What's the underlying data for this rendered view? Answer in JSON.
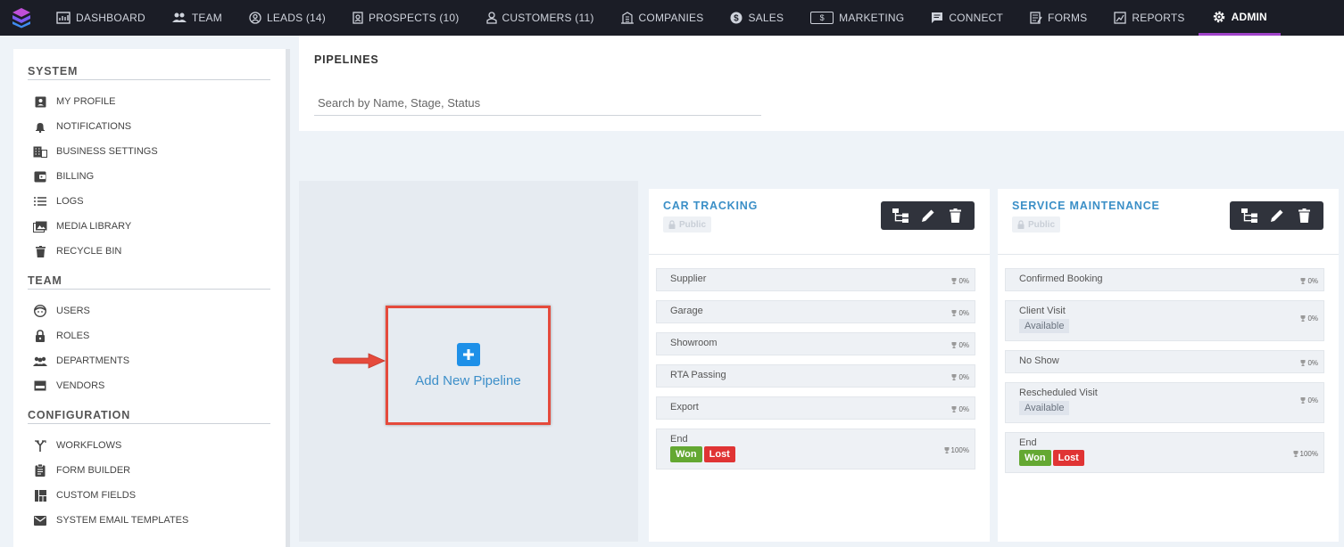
{
  "nav": {
    "items": [
      {
        "label": "DASHBOARD"
      },
      {
        "label": "TEAM"
      },
      {
        "label": "LEADS (14)"
      },
      {
        "label": "PROSPECTS (10)"
      },
      {
        "label": "CUSTOMERS (11)"
      },
      {
        "label": "COMPANIES"
      },
      {
        "label": "SALES"
      },
      {
        "label": "MARKETING"
      },
      {
        "label": "CONNECT"
      },
      {
        "label": "FORMS"
      },
      {
        "label": "REPORTS"
      },
      {
        "label": "ADMIN"
      }
    ],
    "money_glyph": "$",
    "active": "ADMIN",
    "accent": "#a043c9"
  },
  "sidebar": {
    "sections": [
      {
        "title": "SYSTEM",
        "items": [
          "MY PROFILE",
          "NOTIFICATIONS",
          "BUSINESS SETTINGS",
          "BILLING",
          "LOGS",
          "MEDIA LIBRARY",
          "RECYCLE BIN"
        ]
      },
      {
        "title": "TEAM",
        "items": [
          "USERS",
          "ROLES",
          "DEPARTMENTS",
          "VENDORS"
        ]
      },
      {
        "title": "CONFIGURATION",
        "items": [
          "WORKFLOWS",
          "FORM BUILDER",
          "CUSTOM FIELDS",
          "SYSTEM EMAIL TEMPLATES"
        ]
      }
    ]
  },
  "main": {
    "title": "PIPELINES",
    "search_placeholder": "Search by Name, Stage, Status",
    "add_label": "Add New Pipeline"
  },
  "pipelines": [
    {
      "title": "CAR TRACKING",
      "visibility": "Public",
      "stages": [
        {
          "name": "Supplier",
          "pct": "0%"
        },
        {
          "name": "Garage",
          "pct": "0%"
        },
        {
          "name": "Showroom",
          "pct": "0%"
        },
        {
          "name": "RTA Passing",
          "pct": "0%"
        },
        {
          "name": "Export",
          "pct": "0%"
        },
        {
          "name": "End",
          "pct": "100%",
          "won": "Won",
          "lost": "Lost"
        }
      ]
    },
    {
      "title": "SERVICE MAINTENANCE",
      "visibility": "Public",
      "stages": [
        {
          "name": "Confirmed Booking",
          "pct": "0%"
        },
        {
          "name": "Client Visit",
          "pct": "0%",
          "tag": "Available"
        },
        {
          "name": "No Show",
          "pct": "0%"
        },
        {
          "name": "Rescheduled Visit",
          "pct": "0%",
          "tag": "Available"
        },
        {
          "name": "End",
          "pct": "100%",
          "won": "Won",
          "lost": "Lost"
        }
      ]
    }
  ],
  "colors": {
    "won": "#64a832",
    "lost": "#e03434",
    "title_blue": "#3b8fc7",
    "highlight": "#e54a3c"
  }
}
